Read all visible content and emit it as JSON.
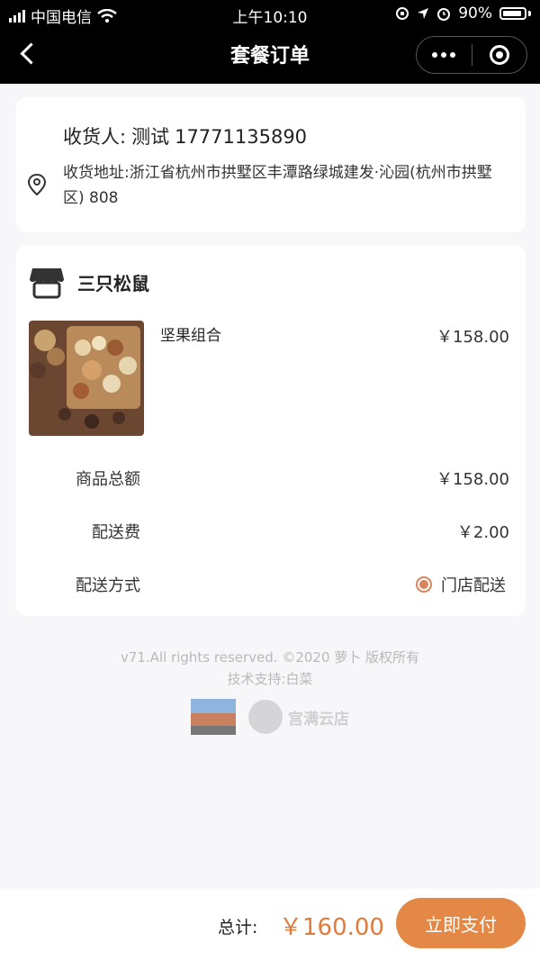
{
  "status_bar": {
    "carrier": "中国电信",
    "time": "上午10:10",
    "battery": "90%"
  },
  "nav": {
    "title": "套餐订单"
  },
  "address": {
    "receiver_label": "收货人:",
    "receiver_name": "测试",
    "receiver_phone": "17771135890",
    "address_text": "收货地址:浙江省杭州市拱墅区丰潭路绿城建发·沁园(杭州市拱墅区) 808"
  },
  "shop": {
    "name": "三只松鼠",
    "product": {
      "name": "坚果组合",
      "price": "￥158.00"
    },
    "rows": {
      "subtotal_label": "商品总额",
      "subtotal_value": "￥158.00",
      "shipping_label": "配送费",
      "shipping_value": "￥2.00",
      "method_label": "配送方式",
      "method_value": "门店配送"
    }
  },
  "footer": {
    "copyright": "v71.All rights reserved. ©2020 萝卜 版权所有",
    "support": "技术支持:白菜",
    "brand_name": "宫满云店"
  },
  "checkout": {
    "total_label": "总计:",
    "total_value": "￥160.00",
    "pay_label": "立即支付"
  },
  "colors": {
    "accent": "#e38846",
    "price_orange": "#e07b3b",
    "radio": "#d9845a"
  }
}
